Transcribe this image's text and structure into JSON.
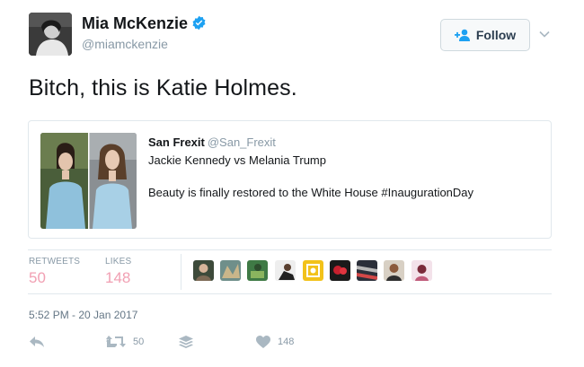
{
  "tweet": {
    "author_name": "Mia McKenzie",
    "author_handle": "@miamckenzie",
    "text": "Bitch, this is Katie Holmes.",
    "follow_label": "Follow",
    "timestamp": "5:52 PM - 20 Jan 2017"
  },
  "quote": {
    "author_name": "San Frexit",
    "author_handle": "@San_Frexit",
    "line1": "Jackie Kennedy vs Melania Trump",
    "line2": "Beauty is finally restored to the White House #InaugurationDay"
  },
  "stats": {
    "retweets_label": "RETWEETS",
    "retweets": "50",
    "likes_label": "LIKES",
    "likes": "148"
  },
  "actions": {
    "retweet_count": "50",
    "like_count": "148"
  },
  "colors": {
    "accent": "#1da1f2",
    "stat_pink": "#f1a0b3"
  },
  "icons": [
    "verified-icon",
    "follow-person-icon",
    "chevron-down-icon",
    "reply-icon",
    "retweet-icon",
    "buffer-icon",
    "heart-icon"
  ]
}
